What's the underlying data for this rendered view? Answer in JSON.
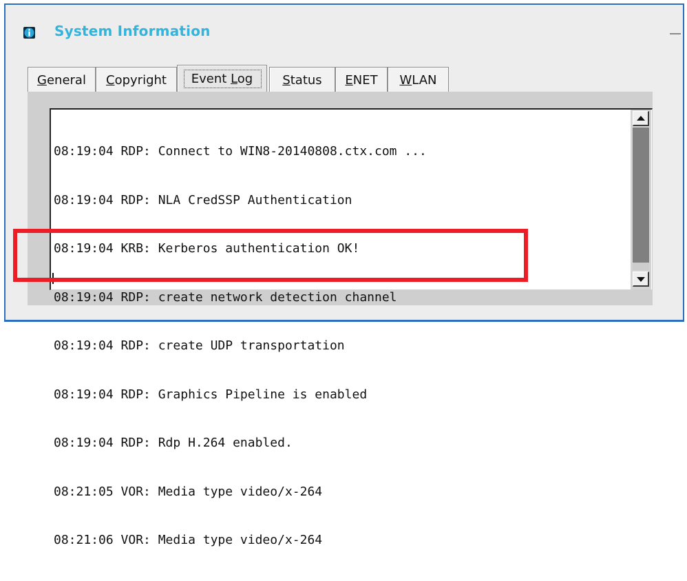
{
  "window": {
    "title": "System Information",
    "info_icon": "info-icon",
    "minimize_icon": "minimize-icon"
  },
  "tabs": [
    {
      "pre": "",
      "accel": "G",
      "post": "eneral",
      "selected": false
    },
    {
      "pre": "",
      "accel": "C",
      "post": "opyright",
      "selected": false
    },
    {
      "pre": "Event ",
      "accel": "L",
      "post": "og",
      "selected": true
    },
    {
      "pre": "",
      "accel": "S",
      "post": "tatus",
      "selected": false
    },
    {
      "pre": "",
      "accel": "E",
      "post": "NET",
      "selected": false
    },
    {
      "pre": "",
      "accel": "W",
      "post": "LAN",
      "selected": false
    }
  ],
  "event_log": {
    "lines": [
      "08:19:04 RDP: Connect to WIN8-20140808.ctx.com ...",
      "08:19:04 RDP: NLA CredSSP Authentication",
      "08:19:04 KRB: Kerberos authentication OK!",
      "08:19:04 RDP: create network detection channel",
      "08:19:04 RDP: create UDP transportation",
      "08:19:04 RDP: Graphics Pipeline is enabled",
      "08:19:04 RDP: Rdp H.264 enabled.",
      "08:21:05 VOR: Media type video/x-264",
      "08:21:06 VOR: Media type video/x-264"
    ],
    "scroll_up_icon": "arrow-up-icon",
    "scroll_down_icon": "arrow-down-icon"
  },
  "annotation": {
    "color": "#ee1c25"
  },
  "colors": {
    "window_border": "#2d6fbf",
    "title_text": "#33b4dc",
    "info_icon_bg": "#0d2a3b",
    "panel_bg": "#cfcfcf",
    "scroll_thumb": "#808080"
  }
}
